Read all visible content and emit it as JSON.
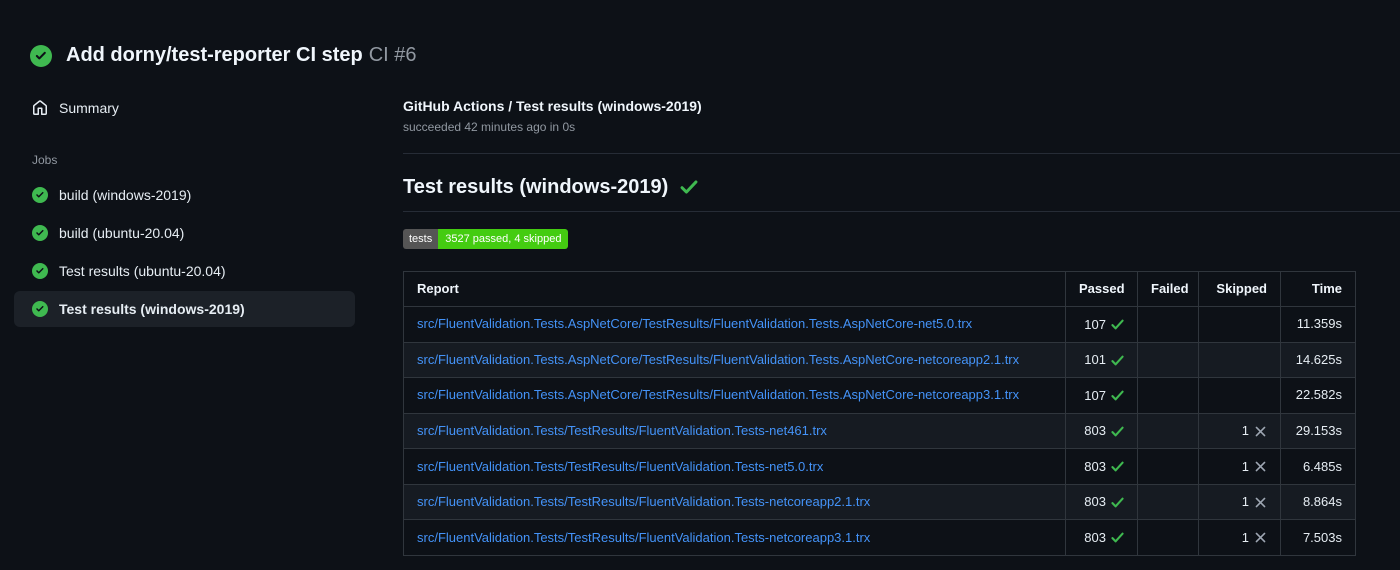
{
  "page": {
    "run_title": "Add dorny/test-reporter CI step",
    "run_number": "CI #6"
  },
  "sidebar": {
    "summary_label": "Summary",
    "jobs_section_label": "Jobs",
    "jobs": [
      {
        "label": "build (windows-2019)",
        "status": "success",
        "selected": false
      },
      {
        "label": "build (ubuntu-20.04)",
        "status": "success",
        "selected": false
      },
      {
        "label": "Test results (ubuntu-20.04)",
        "status": "success",
        "selected": false
      },
      {
        "label": "Test results (windows-2019)",
        "status": "success",
        "selected": true
      }
    ]
  },
  "main": {
    "check_header": {
      "title": "GitHub Actions / Test results (windows-2019)",
      "status_line": "succeeded 42 minutes ago in 0s"
    },
    "section_title": "Test results (windows-2019)",
    "section_status": "success",
    "badge": {
      "label": "tests",
      "value": "3527 passed, 4 skipped",
      "label_bg": "#555555",
      "value_bg": "#44cc11"
    },
    "table": {
      "columns": [
        "Report",
        "Passed",
        "Failed",
        "Skipped",
        "Time"
      ],
      "rows": [
        {
          "report": "src/FluentValidation.Tests.AspNetCore/TestResults/FluentValidation.Tests.AspNetCore-net5.0.trx",
          "passed": "107",
          "failed": "",
          "skipped": "",
          "time": "11.359s"
        },
        {
          "report": "src/FluentValidation.Tests.AspNetCore/TestResults/FluentValidation.Tests.AspNetCore-netcoreapp2.1.trx",
          "passed": "101",
          "failed": "",
          "skipped": "",
          "time": "14.625s"
        },
        {
          "report": "src/FluentValidation.Tests.AspNetCore/TestResults/FluentValidation.Tests.AspNetCore-netcoreapp3.1.trx",
          "passed": "107",
          "failed": "",
          "skipped": "",
          "time": "22.582s"
        },
        {
          "report": "src/FluentValidation.Tests/TestResults/FluentValidation.Tests-net461.trx",
          "passed": "803",
          "failed": "",
          "skipped": "1",
          "time": "29.153s"
        },
        {
          "report": "src/FluentValidation.Tests/TestResults/FluentValidation.Tests-net5.0.trx",
          "passed": "803",
          "failed": "",
          "skipped": "1",
          "time": "6.485s"
        },
        {
          "report": "src/FluentValidation.Tests/TestResults/FluentValidation.Tests-netcoreapp2.1.trx",
          "passed": "803",
          "failed": "",
          "skipped": "1",
          "time": "8.864s"
        },
        {
          "report": "src/FluentValidation.Tests/TestResults/FluentValidation.Tests-netcoreapp3.1.trx",
          "passed": "803",
          "failed": "",
          "skipped": "1",
          "time": "7.503s"
        }
      ]
    }
  },
  "colors": {
    "success_green": "#3fb950",
    "link_blue": "#4493f8",
    "skipped_gray": "#9ea7b3",
    "background": "#0d1117",
    "zebra_row": "#161b22",
    "table_border": "#30363d"
  }
}
